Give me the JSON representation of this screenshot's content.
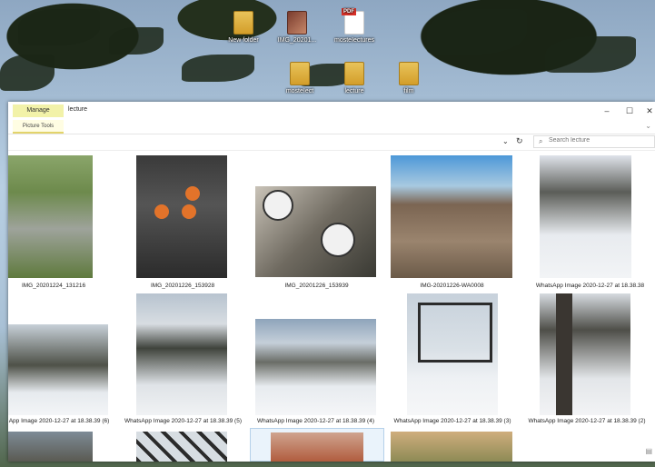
{
  "desktop": {
    "icons": [
      {
        "label": "New folder",
        "type": "folder"
      },
      {
        "label": "IMG_20201...",
        "type": "image"
      },
      {
        "label": "mosteIectures",
        "type": "pdf"
      },
      {
        "label": "mosteIect",
        "type": "folder"
      },
      {
        "label": "lecture",
        "type": "folder"
      },
      {
        "label": "film",
        "type": "folder"
      }
    ]
  },
  "window": {
    "manage_tab": "Manage",
    "title": "lecture",
    "picture_tools": "Picture Tools",
    "minimize": "–",
    "maximize": "☐",
    "close": "✕",
    "search_placeholder": "Search lecture"
  },
  "files": {
    "row1": [
      "IMG_20201224_131216",
      "IMG_20201226_153928",
      "IMG_20201226_153939",
      "IMG-20201226-WA0008",
      "WhatsApp Image 2020-12-27 at 18.38.38"
    ],
    "row2": [
      "App Image 2020-12-27 at 18.38.39 (6)",
      "WhatsApp Image 2020-12-27 at 18.38.39 (5)",
      "WhatsApp Image 2020-12-27 at 18.38.39 (4)",
      "WhatsApp Image 2020-12-27 at 18.38.39 (3)",
      "WhatsApp Image 2020-12-27 at 18.38.39 (2)"
    ]
  },
  "colors": {
    "manage_tab": "#f2f2a9",
    "window_bg": "#ffffff"
  }
}
